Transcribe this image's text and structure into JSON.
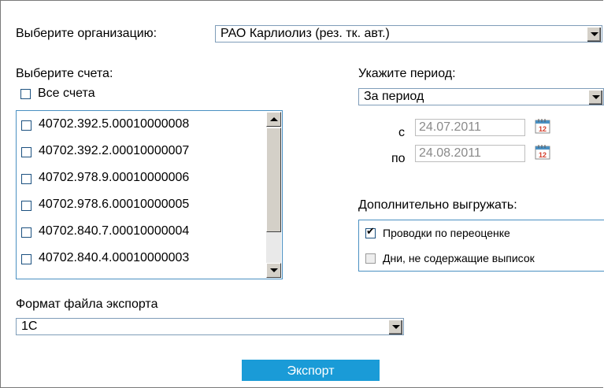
{
  "org": {
    "label": "Выберите организацию:",
    "selected": "РАО Карлиолиз (рез. тк. авт.)"
  },
  "accounts": {
    "label": "Выберите счета:",
    "all_label": "Все счета",
    "items": [
      {
        "number": "40702.392.5.00010000008",
        "checked": false
      },
      {
        "number": "40702.392.2.00010000007",
        "checked": false
      },
      {
        "number": "40702.978.9.00010000006",
        "checked": false
      },
      {
        "number": "40702.978.6.00010000005",
        "checked": false
      },
      {
        "number": "40702.840.7.00010000004",
        "checked": false
      },
      {
        "number": "40702.840.4.00010000003",
        "checked": false
      }
    ]
  },
  "period": {
    "label": "Укажите период:",
    "selected": "За период",
    "from_label": "с",
    "from_value": "24.07.2011",
    "to_label": "по",
    "to_value": "24.08.2011",
    "calendar_day": "12"
  },
  "extra": {
    "label": "Дополнительно выгружать:",
    "options": [
      {
        "label": "Проводки по переоценке",
        "checked": true,
        "enabled": true
      },
      {
        "label": "Дни, не содержащие выписок",
        "checked": false,
        "enabled": false
      }
    ]
  },
  "format": {
    "label": "Формат файла экспорта",
    "selected": "1С"
  },
  "export_button": "Экспорт",
  "colors": {
    "accent": "#1a9bd7",
    "list_border": "#4a90c2"
  }
}
